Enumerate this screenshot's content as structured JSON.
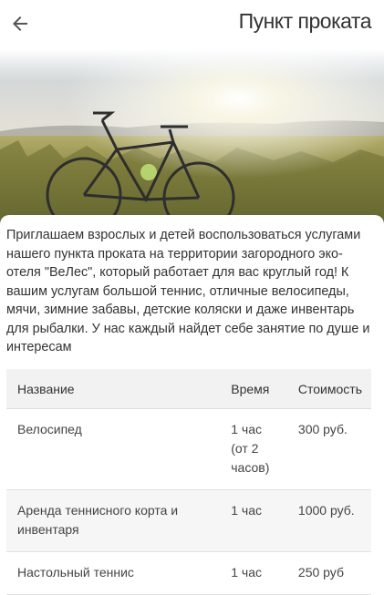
{
  "header": {
    "back_icon": "arrow-left-icon",
    "title": "Пункт проката"
  },
  "hero": {
    "image": "bicycle-in-field-at-sunset"
  },
  "intro_text": "Приглашаем взрослых и детей воспользоваться услугами нашего пункта проката на территории загородного эко-отеля \"ВеЛес\", который работает для вас круглый год! К вашим услугам большой теннис, отличные велосипеды, мячи, зимние забавы, детские коляски и даже инвентарь для рыбалки. У нас каждый найдет себе занятие по душе и интересам",
  "table": {
    "headers": [
      "Название",
      "Время",
      "Стоимость"
    ],
    "rows": [
      [
        "Велосипед",
        "1 час (от 2 часов)",
        "300 руб."
      ],
      [
        "Аренда теннисного корта и инвентаря",
        "1 час",
        "1000 руб."
      ],
      [
        "Настольный теннис",
        "1 час",
        "250 руб"
      ]
    ]
  },
  "colors": {
    "text": "#333333",
    "header_row": "#f2f2f2",
    "stripe_row": "#f6f6f6"
  }
}
